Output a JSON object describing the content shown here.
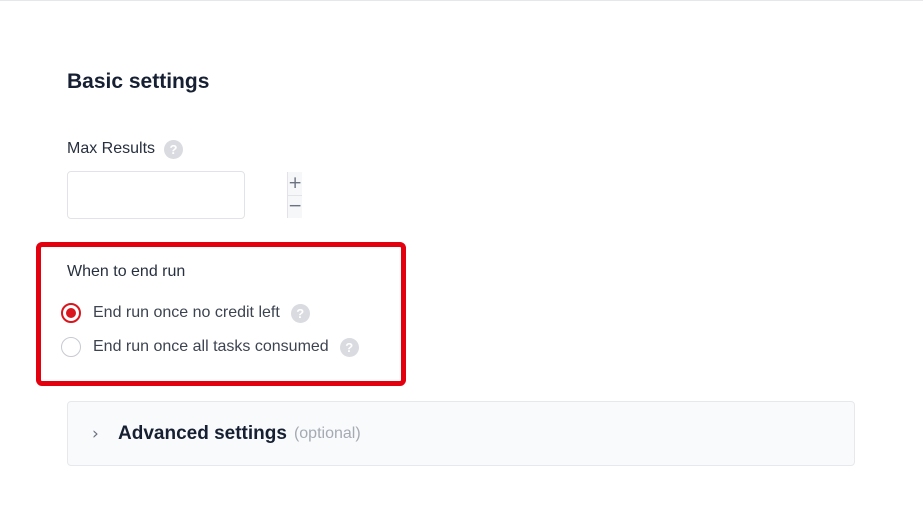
{
  "basic_settings": {
    "title": "Basic settings"
  },
  "max_results": {
    "label": "Max Results",
    "value": "",
    "help_icon": "question-mark",
    "increment_label": "+",
    "decrement_label": "−"
  },
  "end_run": {
    "label": "When to end run",
    "options": [
      {
        "label": "End run once no credit left",
        "selected": true,
        "help_icon": "question-mark"
      },
      {
        "label": "End run once all tasks consumed",
        "selected": false,
        "help_icon": "question-mark"
      }
    ],
    "highlight_color": "#e3000f"
  },
  "advanced": {
    "chevron": "›",
    "title": "Advanced settings",
    "optional": "(optional)",
    "expanded": false
  },
  "colors": {
    "accent": "#d9161e",
    "heading": "#172033"
  }
}
